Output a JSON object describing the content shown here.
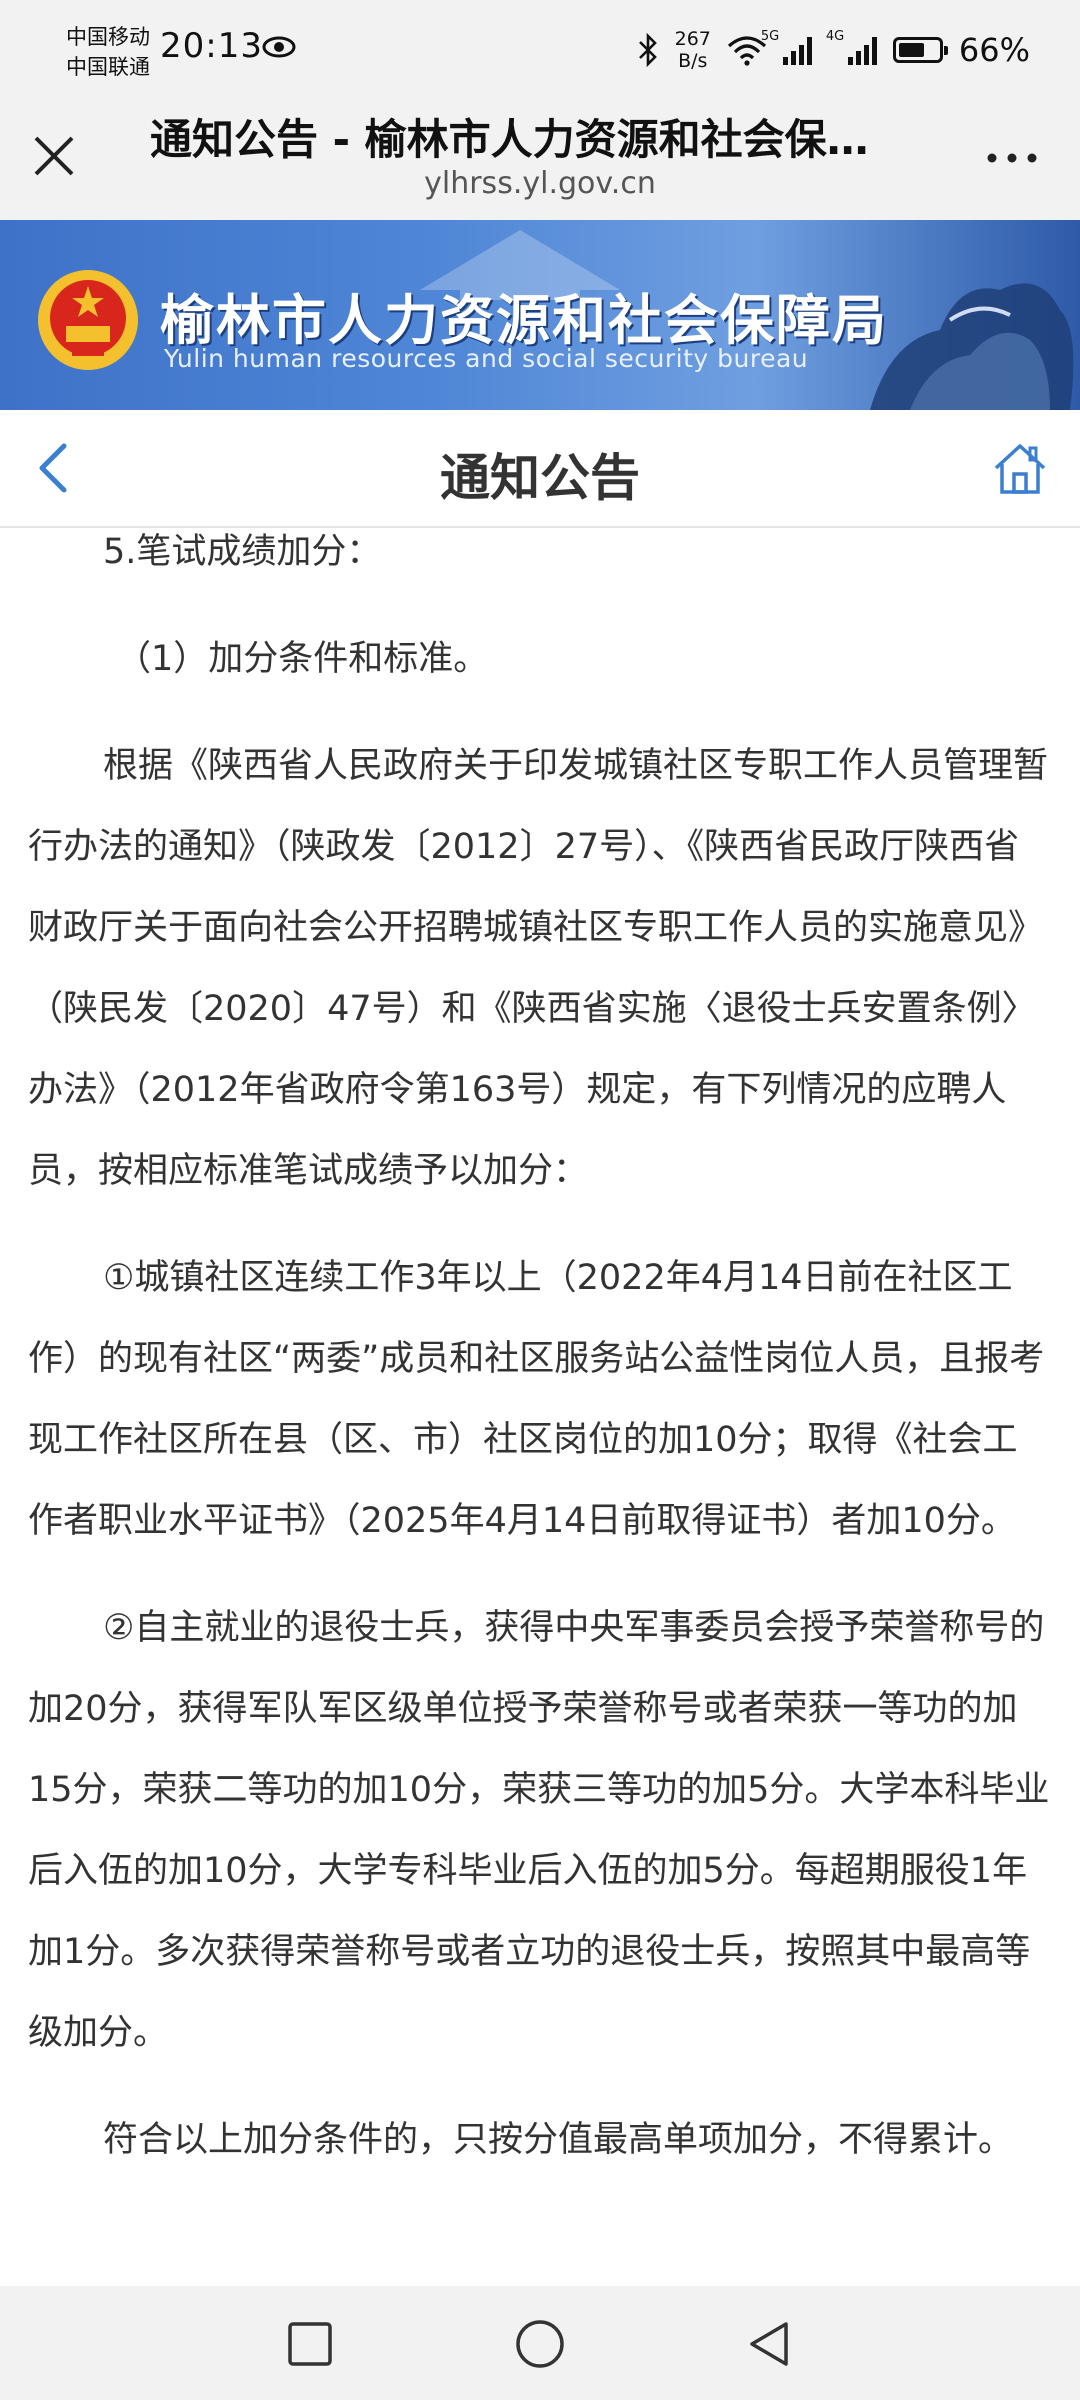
{
  "status_bar": {
    "carrier_1": "中国移动",
    "carrier_2": "中国联通",
    "time": "20:13",
    "net_speed_value": "267",
    "net_speed_unit": "B/s",
    "signal_1_label": "5G",
    "signal_2_label": "4G",
    "battery_percent": "66%",
    "battery_level": 0.66
  },
  "browser": {
    "title": "通知公告 - 榆林市人力资源和社会保…",
    "url": "ylhrss.yl.gov.cn"
  },
  "banner": {
    "title_cn": "榆林市人力资源和社会保障局",
    "title_en": "Yulin human resources and social security bureau"
  },
  "nav": {
    "title": "通知公告"
  },
  "article": {
    "heading_5": "5.笔试成绩加分：",
    "sub_heading": "（1）加分条件和标准。",
    "para_1": "根据《陕西省人民政府关于印发城镇社区专职工作人员管理暂行办法的通知》（陕政发〔2012〕27号）、《陕西省民政厅陕西省财政厅关于面向社会公开招聘城镇社区专职工作人员的实施意见》（陕民发〔2020〕47号）和《陕西省实施〈退役士兵安置条例〉办法》（2012年省政府令第163号）规定，有下列情况的应聘人员，按相应标准笔试成绩予以加分：",
    "para_2": "①城镇社区连续工作3年以上（2022年4月14日前在社区工作）的现有社区“两委”成员和社区服务站公益性岗位人员，且报考现工作社区所在县（区、市）社区岗位的加10分；取得《社会工作者职业水平证书》（2025年4月14日前取得证书）者加10分。",
    "para_3": "②自主就业的退役士兵，获得中央军事委员会授予荣誉称号的加20分，获得军队军区级单位授予荣誉称号或者荣获一等功的加15分，荣获二等功的加10分，荣获三等功的加5分。大学本科毕业后入伍的加10分，大学专科毕业后入伍的加5分。每超期服役1年加1分。多次获得荣誉称号或者立功的退役士兵，按照其中最高等级加分。",
    "para_4": "符合以上加分条件的，只按分值最高单项加分，不得累计。"
  }
}
